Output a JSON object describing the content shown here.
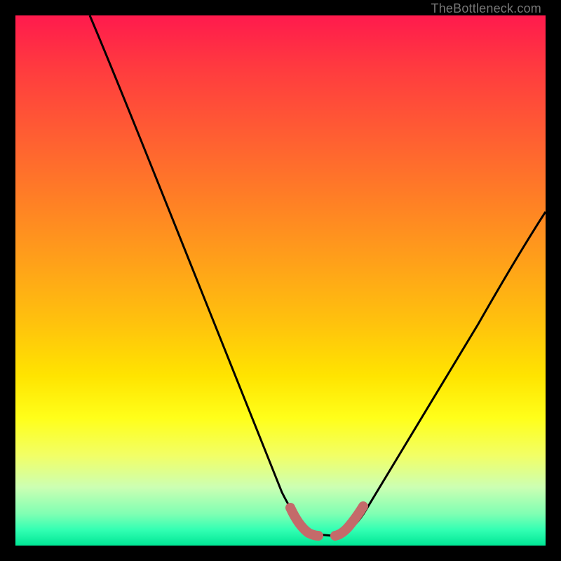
{
  "watermark": "TheBottleneck.com",
  "chart_data": {
    "type": "line",
    "title": "",
    "xlabel": "",
    "ylabel": "",
    "xlim": [
      0,
      100
    ],
    "ylim": [
      0,
      100
    ],
    "grid": false,
    "legend": false,
    "background_gradient": {
      "top": "#ff1a4d",
      "mid": "#ffe400",
      "bottom": "#00e695"
    },
    "series": [
      {
        "name": "bottleneck-curve",
        "note": "Y is percent height from top (0) to bottom (100); X is percent position left→right.",
        "x": [
          14,
          18,
          24,
          30,
          36,
          42,
          48,
          52,
          54,
          56,
          58,
          60,
          62,
          64,
          66,
          70,
          76,
          82,
          88,
          94,
          100
        ],
        "y": [
          0,
          10,
          24,
          38,
          52,
          65,
          78,
          87,
          92,
          95,
          97,
          98,
          98,
          97,
          95,
          91,
          82,
          72,
          61,
          49,
          38
        ]
      }
    ],
    "minimum_marker": {
      "x_range": [
        52,
        64
      ],
      "color": "#c46a6a",
      "shape": "thick-broken-V"
    }
  }
}
